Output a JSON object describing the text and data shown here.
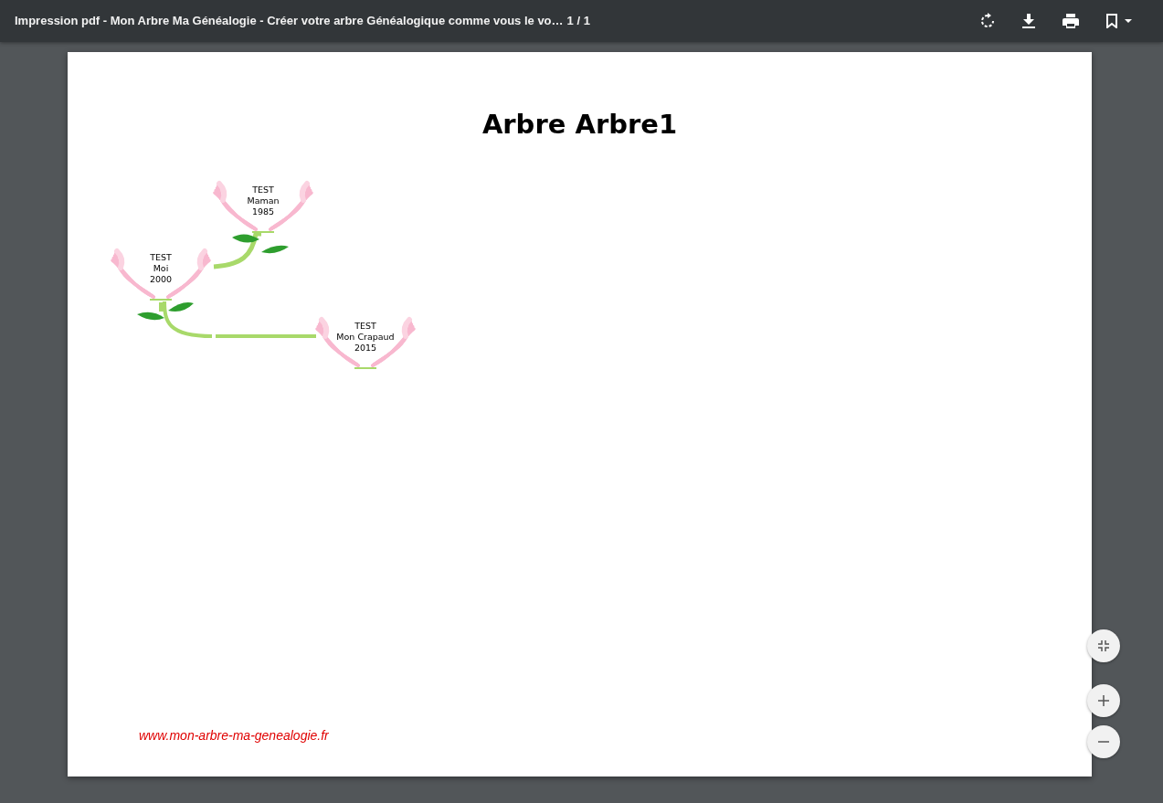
{
  "toolbar": {
    "title": "Impression pdf - Mon Arbre Ma Généalogie - Créer votre arbre Généalogique comme vous le vo…",
    "page_count": "1 / 1"
  },
  "document": {
    "title": "Arbre Arbre1",
    "persons": [
      {
        "surname": "TEST",
        "first_name": "Maman",
        "year": "1985"
      },
      {
        "surname": "TEST",
        "first_name": "Moi",
        "year": "2000"
      },
      {
        "surname": "TEST",
        "first_name": "Mon Crapaud",
        "year": "2015"
      }
    ],
    "footer_link": "www.mon-arbre-ma-genealogie.fr"
  }
}
